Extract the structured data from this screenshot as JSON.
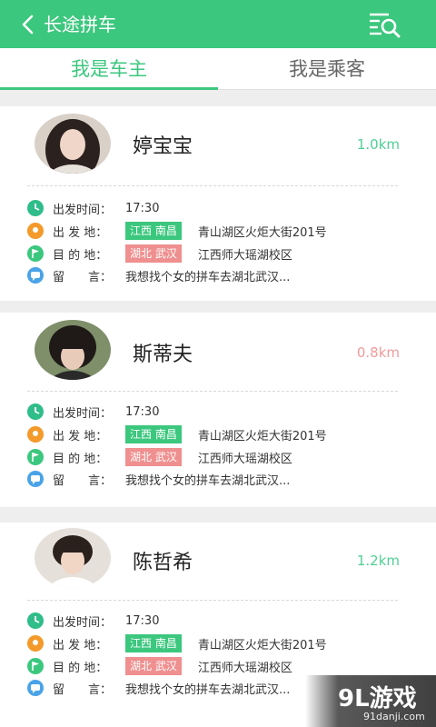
{
  "header": {
    "title": "长途拼车",
    "back_icon": "chevron-left-icon",
    "search_icon": "search-list-icon"
  },
  "tabs": [
    {
      "label": "我是车主",
      "active": true
    },
    {
      "label": "我是乘客",
      "active": false
    }
  ],
  "labels": {
    "depart_time": "出发时间：",
    "origin": "出 发 地：",
    "destination": "目 的 地：",
    "message": "留　　言："
  },
  "cards": [
    {
      "name": "婷宝宝",
      "distance": "1.0km",
      "distance_color": "green",
      "time": "17:30",
      "origin_tag": "江西 南昌",
      "origin_addr": "青山湖区火炬大街201号",
      "dest_tag": "湖北 武汉",
      "dest_addr": "江西师大瑶湖校区",
      "message": "我想找个女的拼车去湖北武汉..."
    },
    {
      "name": "斯蒂夫",
      "distance": "0.8km",
      "distance_color": "red",
      "time": "17:30",
      "origin_tag": "江西 南昌",
      "origin_addr": "青山湖区火炬大街201号",
      "dest_tag": "湖北 武汉",
      "dest_addr": "江西师大瑶湖校区",
      "message": "我想找个女的拼车去湖北武汉..."
    },
    {
      "name": "陈哲希",
      "distance": "1.2km",
      "distance_color": "green",
      "time": "17:30",
      "origin_tag": "江西 南昌",
      "origin_addr": "青山湖区火炬大街201号",
      "dest_tag": "湖北 武汉",
      "dest_addr": "江西师大瑶湖校区",
      "message": "我想找个女的拼车去湖北武汉..."
    }
  ],
  "colors": {
    "primary": "#3cc77e",
    "tag_red": "#ef8f8f",
    "dist_red": "#f29a9a",
    "time_icon": "#2fbd8a",
    "origin_icon": "#f39a2b",
    "dest_icon": "#3cc77e",
    "msg_icon": "#4aa3e8"
  },
  "watermark": {
    "main": "9L游戏",
    "sub": "91danji.com"
  }
}
